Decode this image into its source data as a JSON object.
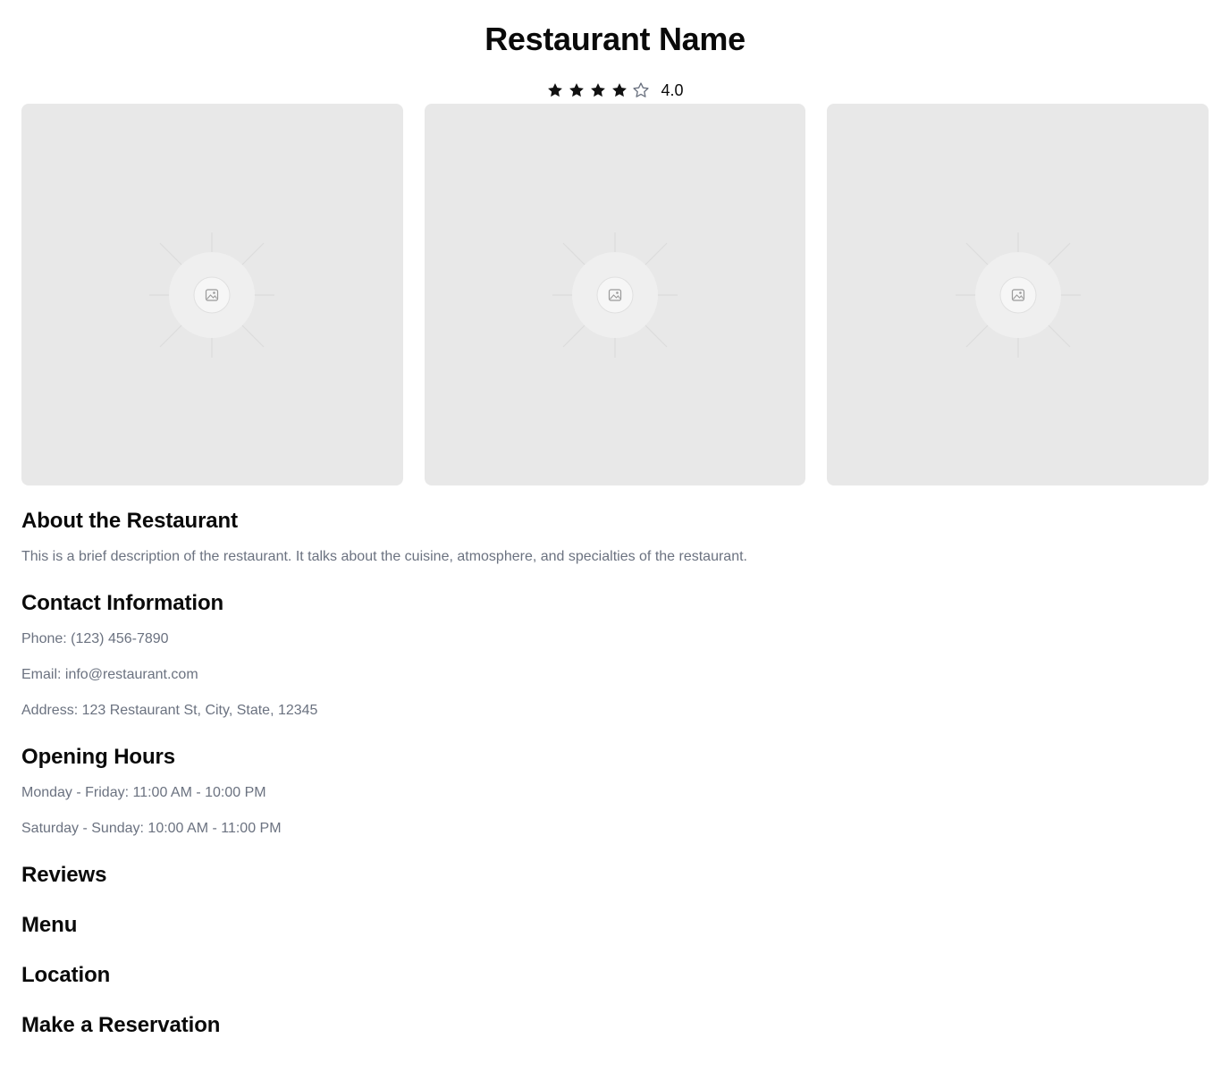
{
  "restaurant": {
    "name": "Restaurant Name",
    "rating_value": "4.0",
    "rating": 4,
    "rating_max": 5
  },
  "gallery": {
    "image_count": 3
  },
  "about": {
    "title": "About the Restaurant",
    "description": "This is a brief description of the restaurant. It talks about the cuisine, atmosphere, and specialties of the restaurant."
  },
  "contact": {
    "title": "Contact Information",
    "phone": "Phone: (123) 456-7890",
    "email": "Email: info@restaurant.com",
    "address": "Address: 123 Restaurant St, City, State, 12345"
  },
  "hours": {
    "title": "Opening Hours",
    "weekdays": "Monday - Friday: 11:00 AM - 10:00 PM",
    "weekend": "Saturday - Sunday: 10:00 AM - 11:00 PM"
  },
  "sections": {
    "reviews": "Reviews",
    "menu": "Menu",
    "location": "Location",
    "reservation": "Make a Reservation"
  },
  "colors": {
    "text": "#0a0a0a",
    "muted": "#6b7280",
    "placeholder_bg": "#e8e8e8",
    "star_filled": "#111111",
    "star_empty": "#6b7280"
  }
}
